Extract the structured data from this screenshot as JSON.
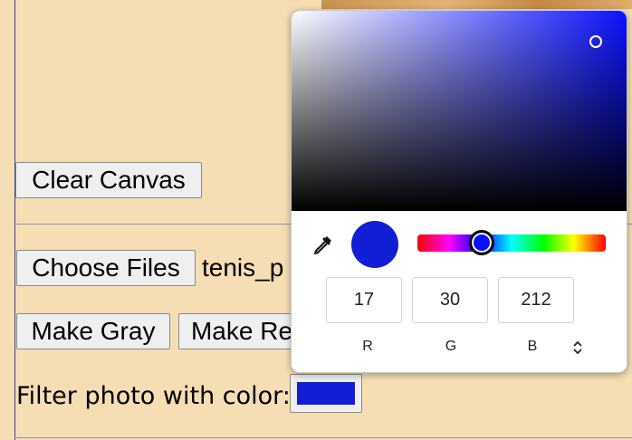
{
  "buttons": {
    "clear_canvas": "Clear Canvas",
    "choose_files": "Choose Files",
    "make_gray": "Make Gray",
    "make_red": "Make Re"
  },
  "file": {
    "name": "tenis_p"
  },
  "filter": {
    "label": "Filter photo with color:",
    "color": "#111ed4"
  },
  "picker": {
    "hue_color": "#0a10ff",
    "rgb": {
      "r": "17",
      "g": "30",
      "b": "212"
    },
    "labels": {
      "r": "R",
      "g": "G",
      "b": "B"
    },
    "toggle_icon": "up-down-chevron-icon",
    "eyedropper_icon": "eyedropper-icon"
  }
}
